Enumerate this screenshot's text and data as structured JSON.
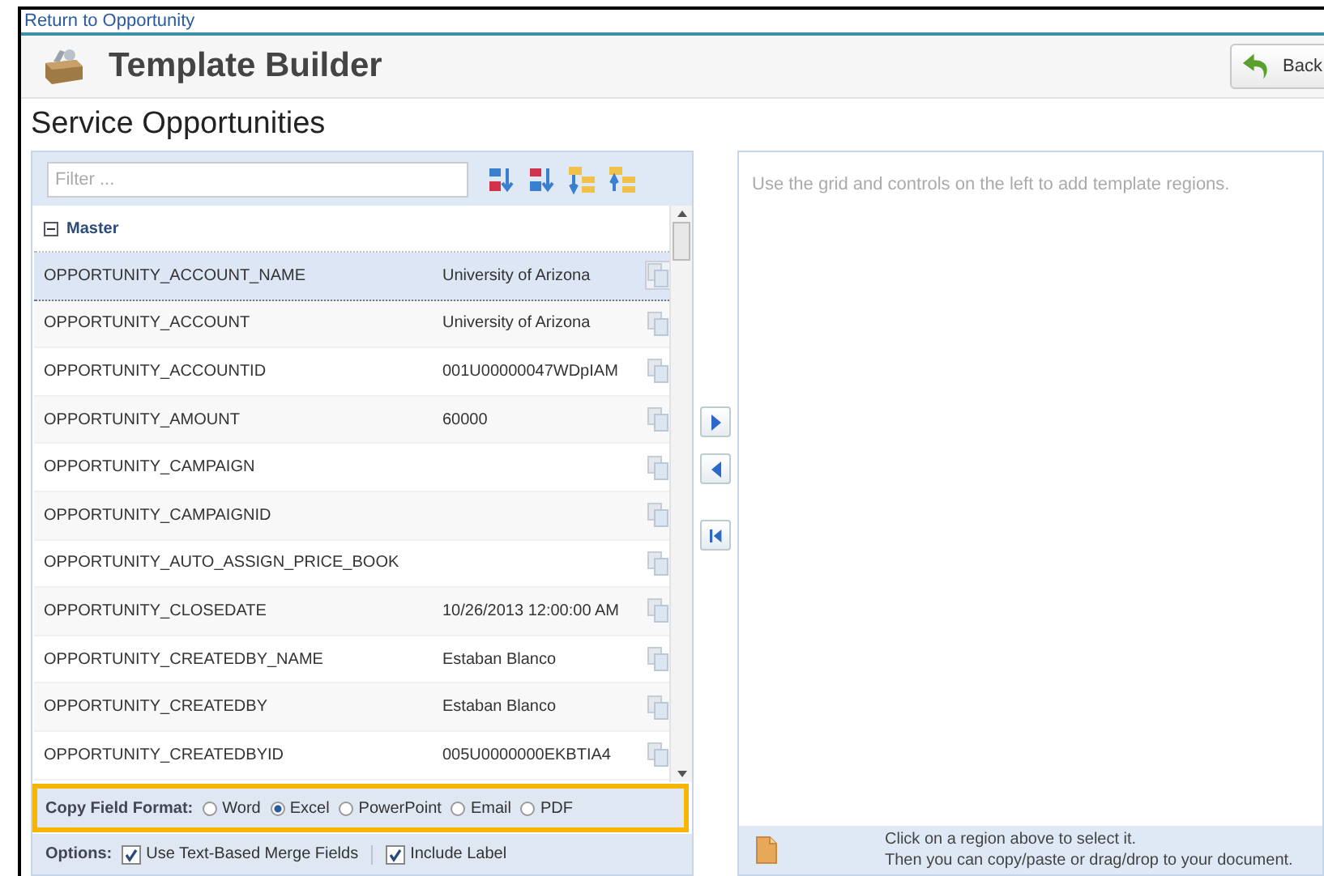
{
  "link": "Return to Opportunity",
  "header": {
    "title": "Template Builder",
    "back_button": "Back"
  },
  "subtitle": "Service Opportunities",
  "filter": {
    "placeholder": "Filter ..."
  },
  "group": {
    "label": "Master",
    "expanded": true
  },
  "fields": [
    {
      "name": "OPPORTUNITY_ACCOUNT_NAME",
      "value": "University of Arizona",
      "selected": true
    },
    {
      "name": "OPPORTUNITY_ACCOUNT",
      "value": "University of Arizona",
      "selected": false
    },
    {
      "name": "OPPORTUNITY_ACCOUNTID",
      "value": "001U00000047WDpIAM",
      "selected": false
    },
    {
      "name": "OPPORTUNITY_AMOUNT",
      "value": "60000",
      "selected": false
    },
    {
      "name": "OPPORTUNITY_CAMPAIGN",
      "selected": false
    },
    {
      "name": "OPPORTUNITY_CAMPAIGNID",
      "selected": false
    },
    {
      "name": "OPPORTUNITY_AUTO_ASSIGN_PRICE_BOOK",
      "selected": false
    },
    {
      "name": "OPPORTUNITY_CLOSEDATE",
      "value": "10/26/2013 12:00:00 AM",
      "selected": false
    },
    {
      "name": "OPPORTUNITY_CREATEDBY_NAME",
      "value": "Estaban Blanco",
      "selected": false
    },
    {
      "name": "OPPORTUNITY_CREATEDBY",
      "value": "Estaban Blanco",
      "selected": false
    },
    {
      "name": "OPPORTUNITY_CREATEDBYID",
      "value": "005U0000000EKBTIA4",
      "selected": false
    }
  ],
  "copy_format": {
    "label": "Copy Field Format:",
    "options": [
      {
        "label": "Word",
        "selected": false
      },
      {
        "label": "Excel",
        "selected": true
      },
      {
        "label": "PowerPoint",
        "selected": false
      },
      {
        "label": "Email",
        "selected": false
      },
      {
        "label": "PDF",
        "selected": false
      }
    ]
  },
  "options": {
    "label": "Options:",
    "checkboxes": [
      {
        "label": "Use Text-Based Merge Fields",
        "checked": true
      },
      {
        "label": "Include Label",
        "checked": true
      }
    ]
  },
  "canvas": {
    "hint": "Use the grid and controls on the left to add template regions."
  },
  "status": {
    "lines": [
      "Click on a region above to select it.",
      "Then you can copy/paste or drag/drop to your document."
    ]
  }
}
